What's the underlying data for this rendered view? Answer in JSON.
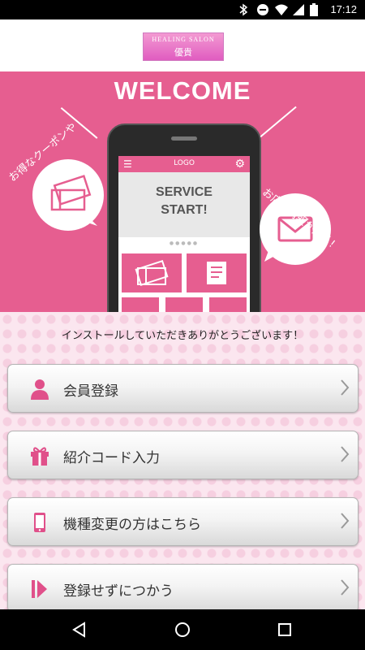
{
  "status_bar": {
    "time": "17:12"
  },
  "header": {
    "logo_line1": "HEALING SALON",
    "logo_line2": "優貴"
  },
  "hero": {
    "title": "WELCOME",
    "left_bubble_text": "お得なクーポンや",
    "right_bubble_text": "お店の情報が届く!",
    "phone": {
      "logo": "LOGO",
      "service_text_1": "SERVICE",
      "service_text_2": "START!"
    }
  },
  "main": {
    "thanks_text": "インストールしていただきありがとうございます！",
    "buttons": [
      {
        "label": "会員登録",
        "icon": "person-icon"
      },
      {
        "label": "紹介コード入力",
        "icon": "gift-icon"
      },
      {
        "label": "機種変更の方はこちら",
        "icon": "smartphone-icon"
      },
      {
        "label": "登録せずにつかう",
        "icon": "skip-icon"
      }
    ]
  },
  "colors": {
    "accent": "#e65e90",
    "icon_pink": "#e0508a"
  }
}
